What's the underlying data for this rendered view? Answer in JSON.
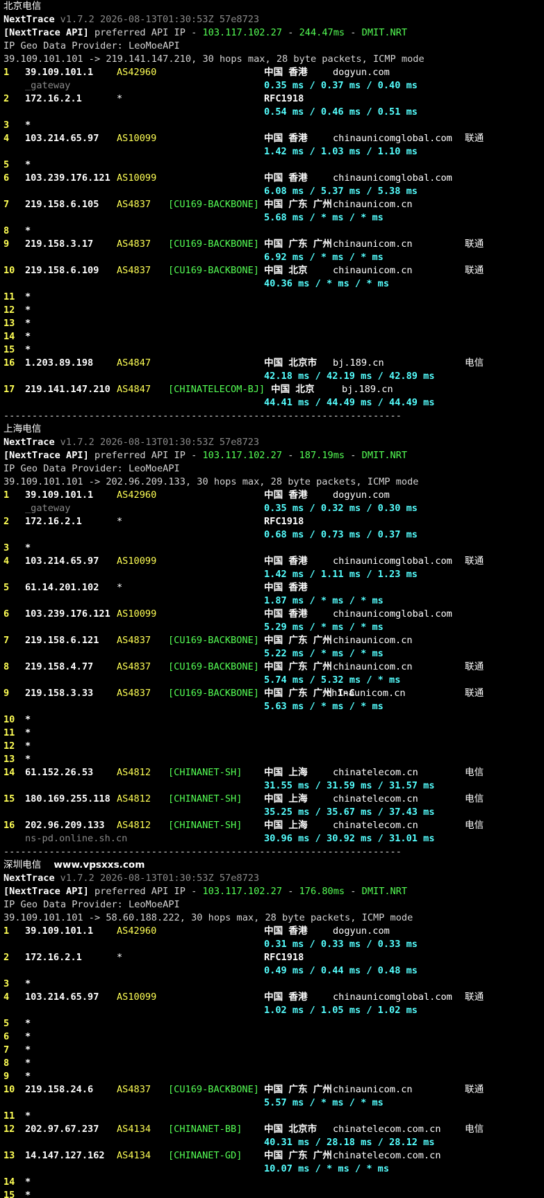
{
  "colors": {
    "hop": "#ffff55",
    "as": "#ffff55",
    "tag": "#55ff55",
    "rtt": "#55ffff",
    "dim": "#8a8a8a",
    "text": "#d4d4d4",
    "white": "#ffffff"
  },
  "separator": "----------------------------------------------------------------------",
  "sections": [
    {
      "title": "北京电信",
      "watermark": "",
      "tool": "NextTrace",
      "version": "v1.7.2 2026-08-13T01:30:53Z 57e8723",
      "api_prefix": "[NextTrace API]",
      "api_mid": " preferred API IP - ",
      "api_ip": "103.117.102.27",
      "api_dash1": " - ",
      "api_ms": "244.47ms",
      "api_dash2": " - ",
      "api_node": "DMIT.NRT",
      "provider": "IP Geo Data Provider: LeoMoeAPI",
      "trace": "39.109.101.101 -> 219.141.147.210, 30 hops max, 28 byte packets, ICMP mode",
      "hops": [
        {
          "n": "1",
          "ip": "39.109.101.1",
          "as": "AS42960",
          "tag": "",
          "geo": "中国 香港",
          "host": "dogyun.com",
          "isp": "",
          "rtt": "0.35 ms / 0.37 ms / 0.40 ms",
          "sub": "_gateway"
        },
        {
          "n": "2",
          "ip": "172.16.2.1",
          "as": "*",
          "tag": "",
          "geo": "RFC1918",
          "host": "",
          "isp": "",
          "rtt": "0.54 ms / 0.46 ms / 0.51 ms",
          "sub": ""
        },
        {
          "n": "3",
          "ip": "*"
        },
        {
          "n": "4",
          "ip": "103.214.65.97",
          "as": "AS10099",
          "tag": "",
          "geo": "中国 香港",
          "host": "chinaunicomglobal.com",
          "isp": "联通",
          "rtt": "1.42 ms / 1.03 ms / 1.10 ms",
          "sub": ""
        },
        {
          "n": "5",
          "ip": "*"
        },
        {
          "n": "6",
          "ip": "103.239.176.121",
          "as": "AS10099",
          "tag": "",
          "geo": "中国 香港",
          "host": "chinaunicomglobal.com",
          "isp": "",
          "rtt": "6.08 ms / 5.37 ms / 5.38 ms",
          "sub": ""
        },
        {
          "n": "7",
          "ip": "219.158.6.105",
          "as": "AS4837",
          "tag": "[CU169-BACKBONE]",
          "geo": "中国 广东 广州",
          "host": "chinaunicom.cn",
          "isp": "",
          "rtt": "5.68 ms / * ms / * ms",
          "sub": ""
        },
        {
          "n": "8",
          "ip": "*"
        },
        {
          "n": "9",
          "ip": "219.158.3.17",
          "as": "AS4837",
          "tag": "[CU169-BACKBONE]",
          "geo": "中国 广东 广州",
          "host": "chinaunicom.cn",
          "isp": "联通",
          "rtt": "6.92 ms / * ms / * ms",
          "sub": ""
        },
        {
          "n": "10",
          "ip": "219.158.6.109",
          "as": "AS4837",
          "tag": "[CU169-BACKBONE]",
          "geo": "中国 北京",
          "host": "chinaunicom.cn",
          "isp": "联通",
          "rtt": "40.36 ms / * ms / * ms",
          "sub": ""
        },
        {
          "n": "11",
          "ip": "*"
        },
        {
          "n": "12",
          "ip": "*"
        },
        {
          "n": "13",
          "ip": "*"
        },
        {
          "n": "14",
          "ip": "*"
        },
        {
          "n": "15",
          "ip": "*"
        },
        {
          "n": "16",
          "ip": "1.203.89.198",
          "as": "AS4847",
          "tag": "",
          "geo": "中国 北京市",
          "host": "bj.189.cn",
          "isp": "电信",
          "rtt": "42.18 ms / 42.19 ms / 42.89 ms",
          "sub": ""
        },
        {
          "n": "17",
          "ip": "219.141.147.210",
          "as": "AS4847",
          "tag": "[CHINATELECOM-BJ]",
          "geo": "中国 北京",
          "host": "bj.189.cn",
          "isp": "",
          "rtt": "44.41 ms / 44.49 ms / 44.49 ms",
          "sub": "",
          "geo_shift": true
        }
      ]
    },
    {
      "title": "上海电信",
      "watermark": "",
      "tool": "NextTrace",
      "version": "v1.7.2 2026-08-13T01:30:53Z 57e8723",
      "api_prefix": "[NextTrace API]",
      "api_mid": " preferred API IP - ",
      "api_ip": "103.117.102.27",
      "api_dash1": " - ",
      "api_ms": "187.19ms",
      "api_dash2": " - ",
      "api_node": "DMIT.NRT",
      "provider": "IP Geo Data Provider: LeoMoeAPI",
      "trace": "39.109.101.101 -> 202.96.209.133, 30 hops max, 28 byte packets, ICMP mode",
      "hops": [
        {
          "n": "1",
          "ip": "39.109.101.1",
          "as": "AS42960",
          "tag": "",
          "geo": "中国 香港",
          "host": "dogyun.com",
          "isp": "",
          "rtt": "0.35 ms / 0.32 ms / 0.30 ms",
          "sub": "_gateway"
        },
        {
          "n": "2",
          "ip": "172.16.2.1",
          "as": "*",
          "tag": "",
          "geo": "RFC1918",
          "host": "",
          "isp": "",
          "rtt": "0.68 ms / 0.73 ms / 0.37 ms",
          "sub": ""
        },
        {
          "n": "3",
          "ip": "*"
        },
        {
          "n": "4",
          "ip": "103.214.65.97",
          "as": "AS10099",
          "tag": "",
          "geo": "中国 香港",
          "host": "chinaunicomglobal.com",
          "isp": "联通",
          "rtt": "1.42 ms / 1.11 ms / 1.23 ms",
          "sub": ""
        },
        {
          "n": "5",
          "ip": "61.14.201.102",
          "as": "*",
          "tag": "",
          "geo": "中国 香港",
          "host": "",
          "isp": "",
          "rtt": "1.87 ms / * ms / * ms",
          "sub": ""
        },
        {
          "n": "6",
          "ip": "103.239.176.121",
          "as": "AS10099",
          "tag": "",
          "geo": "中国 香港",
          "host": "chinaunicomglobal.com",
          "isp": "",
          "rtt": "5.29 ms / * ms / * ms",
          "sub": ""
        },
        {
          "n": "7",
          "ip": "219.158.6.121",
          "as": "AS4837",
          "tag": "[CU169-BACKBONE]",
          "geo": "中国 广东 广州",
          "host": "chinaunicom.cn",
          "isp": "",
          "rtt": "5.22 ms / * ms / * ms",
          "sub": ""
        },
        {
          "n": "8",
          "ip": "219.158.4.77",
          "as": "AS4837",
          "tag": "[CU169-BACKBONE]",
          "geo": "中国 广东 广州",
          "host": "chinaunicom.cn",
          "isp": "联通",
          "rtt": "5.74 ms / 5.32 ms / * ms",
          "sub": ""
        },
        {
          "n": "9",
          "ip": "219.158.3.33",
          "as": "AS4837",
          "tag": "[CU169-BACKBONE]",
          "geo": "中国 广东 广州 I-C",
          "host": "chinaunicom.cn",
          "isp": "联通",
          "rtt": "5.63 ms / * ms / * ms",
          "sub": "",
          "host_tight": true
        },
        {
          "n": "10",
          "ip": "*"
        },
        {
          "n": "11",
          "ip": "*"
        },
        {
          "n": "12",
          "ip": "*"
        },
        {
          "n": "13",
          "ip": "*"
        },
        {
          "n": "14",
          "ip": "61.152.26.53",
          "as": "AS4812",
          "tag": "[CHINANET-SH]",
          "geo": "中国 上海",
          "host": "chinatelecom.cn",
          "isp": "电信",
          "rtt": "31.55 ms / 31.59 ms / 31.57 ms",
          "sub": ""
        },
        {
          "n": "15",
          "ip": "180.169.255.118",
          "as": "AS4812",
          "tag": "[CHINANET-SH]",
          "geo": "中国 上海",
          "host": "chinatelecom.cn",
          "isp": "电信",
          "rtt": "35.25 ms / 35.67 ms / 37.43 ms",
          "sub": ""
        },
        {
          "n": "16",
          "ip": "202.96.209.133",
          "as": "AS4812",
          "tag": "[CHINANET-SH]",
          "geo": "中国 上海",
          "host": "chinatelecom.cn",
          "isp": "电信",
          "rtt": "30.96 ms / 30.92 ms / 31.01 ms",
          "sub": "ns-pd.online.sh.cn"
        }
      ]
    },
    {
      "title": "深圳电信",
      "watermark": "www.vpsxxs.com",
      "tool": "NextTrace",
      "version": "v1.7.2 2026-08-13T01:30:53Z 57e8723",
      "api_prefix": "[NextTrace API]",
      "api_mid": " preferred API IP - ",
      "api_ip": "103.117.102.27",
      "api_dash1": " - ",
      "api_ms": "176.80ms",
      "api_dash2": " - ",
      "api_node": "DMIT.NRT",
      "provider": "IP Geo Data Provider: LeoMoeAPI",
      "trace": "39.109.101.101 -> 58.60.188.222, 30 hops max, 28 byte packets, ICMP mode",
      "hops": [
        {
          "n": "1",
          "ip": "39.109.101.1",
          "as": "AS42960",
          "tag": "",
          "geo": "中国 香港",
          "host": "dogyun.com",
          "isp": "",
          "rtt": "0.31 ms / 0.33 ms / 0.33 ms",
          "sub": ""
        },
        {
          "n": "2",
          "ip": "172.16.2.1",
          "as": "*",
          "tag": "",
          "geo": "RFC1918",
          "host": "",
          "isp": "",
          "rtt": "0.49 ms / 0.44 ms / 0.48 ms",
          "sub": ""
        },
        {
          "n": "3",
          "ip": "*"
        },
        {
          "n": "4",
          "ip": "103.214.65.97",
          "as": "AS10099",
          "tag": "",
          "geo": "中国 香港",
          "host": "chinaunicomglobal.com",
          "isp": "联通",
          "rtt": "1.02 ms / 1.05 ms / 1.02 ms",
          "sub": ""
        },
        {
          "n": "5",
          "ip": "*"
        },
        {
          "n": "6",
          "ip": "*"
        },
        {
          "n": "7",
          "ip": "*"
        },
        {
          "n": "8",
          "ip": "*"
        },
        {
          "n": "9",
          "ip": "*"
        },
        {
          "n": "10",
          "ip": "219.158.24.6",
          "as": "AS4837",
          "tag": "[CU169-BACKBONE]",
          "geo": "中国 广东 广州",
          "host": "chinaunicom.cn",
          "isp": "联通",
          "rtt": "5.57 ms / * ms / * ms",
          "sub": ""
        },
        {
          "n": "11",
          "ip": "*"
        },
        {
          "n": "12",
          "ip": "202.97.67.237",
          "as": "AS4134",
          "tag": "[CHINANET-BB]",
          "geo": "中国 北京市",
          "host": "chinatelecom.com.cn",
          "isp": "电信",
          "rtt": "40.31 ms / 28.18 ms / 28.12 ms",
          "sub": ""
        },
        {
          "n": "13",
          "ip": "14.147.127.162",
          "as": "AS4134",
          "tag": "[CHINANET-GD]",
          "geo": "中国 广东 广州",
          "host": "chinatelecom.com.cn",
          "isp": "",
          "rtt": "10.07 ms / * ms / * ms",
          "sub": ""
        },
        {
          "n": "14",
          "ip": "*"
        },
        {
          "n": "15",
          "ip": "*"
        }
      ]
    }
  ]
}
